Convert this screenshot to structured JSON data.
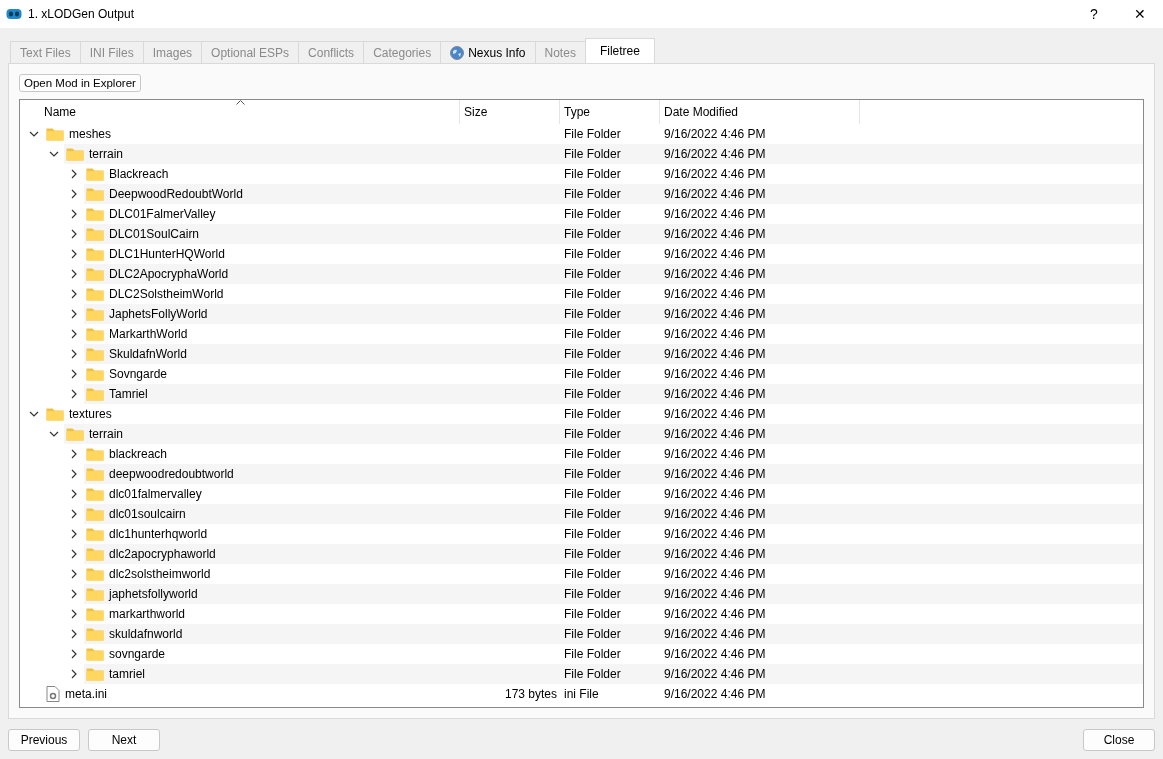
{
  "window": {
    "title": "1. xLODGen Output",
    "help_button": "?",
    "close_button": "✕"
  },
  "tabs": [
    {
      "label": "Text Files",
      "selected": false,
      "disabled": true
    },
    {
      "label": "INI Files",
      "selected": false,
      "disabled": true
    },
    {
      "label": "Images",
      "selected": false,
      "disabled": true
    },
    {
      "label": "Optional ESPs",
      "selected": false,
      "disabled": true
    },
    {
      "label": "Conflicts",
      "selected": false,
      "disabled": true
    },
    {
      "label": "Categories",
      "selected": false,
      "disabled": true
    },
    {
      "label": "Nexus Info",
      "selected": false,
      "disabled": false,
      "kind": "web"
    },
    {
      "label": "Notes",
      "selected": false,
      "disabled": true
    },
    {
      "label": "Filetree",
      "selected": true,
      "disabled": false
    }
  ],
  "open_button": "Open Mod in Explorer",
  "tree": {
    "columns": [
      "Name",
      "Size",
      "Type",
      "Date Modified"
    ],
    "items": [
      {
        "name": "meshes",
        "kind": "folder",
        "type": "File Folder",
        "date": "9/16/2022 4:46 PM",
        "expanded": true,
        "children": [
          {
            "name": "terrain",
            "kind": "folder",
            "type": "File Folder",
            "date": "9/16/2022 4:46 PM",
            "expanded": true,
            "children": [
              {
                "name": "Blackreach",
                "kind": "folder",
                "type": "File Folder",
                "date": "9/16/2022 4:46 PM",
                "expanded": false
              },
              {
                "name": "DeepwoodRedoubtWorld",
                "kind": "folder",
                "type": "File Folder",
                "date": "9/16/2022 4:46 PM",
                "expanded": false
              },
              {
                "name": "DLC01FalmerValley",
                "kind": "folder",
                "type": "File Folder",
                "date": "9/16/2022 4:46 PM",
                "expanded": false
              },
              {
                "name": "DLC01SoulCairn",
                "kind": "folder",
                "type": "File Folder",
                "date": "9/16/2022 4:46 PM",
                "expanded": false
              },
              {
                "name": "DLC1HunterHQWorld",
                "kind": "folder",
                "type": "File Folder",
                "date": "9/16/2022 4:46 PM",
                "expanded": false
              },
              {
                "name": "DLC2ApocryphaWorld",
                "kind": "folder",
                "type": "File Folder",
                "date": "9/16/2022 4:46 PM",
                "expanded": false
              },
              {
                "name": "DLC2SolstheimWorld",
                "kind": "folder",
                "type": "File Folder",
                "date": "9/16/2022 4:46 PM",
                "expanded": false
              },
              {
                "name": "JaphetsFollyWorld",
                "kind": "folder",
                "type": "File Folder",
                "date": "9/16/2022 4:46 PM",
                "expanded": false
              },
              {
                "name": "MarkarthWorld",
                "kind": "folder",
                "type": "File Folder",
                "date": "9/16/2022 4:46 PM",
                "expanded": false
              },
              {
                "name": "SkuldafnWorld",
                "kind": "folder",
                "type": "File Folder",
                "date": "9/16/2022 4:46 PM",
                "expanded": false
              },
              {
                "name": "Sovngarde",
                "kind": "folder",
                "type": "File Folder",
                "date": "9/16/2022 4:46 PM",
                "expanded": false
              },
              {
                "name": "Tamriel",
                "kind": "folder",
                "type": "File Folder",
                "date": "9/16/2022 4:46 PM",
                "expanded": false
              }
            ]
          }
        ]
      },
      {
        "name": "textures",
        "kind": "folder",
        "type": "File Folder",
        "date": "9/16/2022 4:46 PM",
        "expanded": true,
        "children": [
          {
            "name": "terrain",
            "kind": "folder",
            "type": "File Folder",
            "date": "9/16/2022 4:46 PM",
            "expanded": true,
            "children": [
              {
                "name": "blackreach",
                "kind": "folder",
                "type": "File Folder",
                "date": "9/16/2022 4:46 PM",
                "expanded": false
              },
              {
                "name": "deepwoodredoubtworld",
                "kind": "folder",
                "type": "File Folder",
                "date": "9/16/2022 4:46 PM",
                "expanded": false
              },
              {
                "name": "dlc01falmervalley",
                "kind": "folder",
                "type": "File Folder",
                "date": "9/16/2022 4:46 PM",
                "expanded": false
              },
              {
                "name": "dlc01soulcairn",
                "kind": "folder",
                "type": "File Folder",
                "date": "9/16/2022 4:46 PM",
                "expanded": false
              },
              {
                "name": "dlc1hunterhqworld",
                "kind": "folder",
                "type": "File Folder",
                "date": "9/16/2022 4:46 PM",
                "expanded": false
              },
              {
                "name": "dlc2apocryphaworld",
                "kind": "folder",
                "type": "File Folder",
                "date": "9/16/2022 4:46 PM",
                "expanded": false
              },
              {
                "name": "dlc2solstheimworld",
                "kind": "folder",
                "type": "File Folder",
                "date": "9/16/2022 4:46 PM",
                "expanded": false
              },
              {
                "name": "japhetsfollyworld",
                "kind": "folder",
                "type": "File Folder",
                "date": "9/16/2022 4:46 PM",
                "expanded": false
              },
              {
                "name": "markarthworld",
                "kind": "folder",
                "type": "File Folder",
                "date": "9/16/2022 4:46 PM",
                "expanded": false
              },
              {
                "name": "skuldafnworld",
                "kind": "folder",
                "type": "File Folder",
                "date": "9/16/2022 4:46 PM",
                "expanded": false
              },
              {
                "name": "sovngarde",
                "kind": "folder",
                "type": "File Folder",
                "date": "9/16/2022 4:46 PM",
                "expanded": false
              },
              {
                "name": "tamriel",
                "kind": "folder",
                "type": "File Folder",
                "date": "9/16/2022 4:46 PM",
                "expanded": false
              }
            ]
          }
        ]
      },
      {
        "name": "meta.ini",
        "kind": "file",
        "size": "173 bytes",
        "type": "ini File",
        "date": "9/16/2022 4:46 PM"
      }
    ]
  },
  "buttons": {
    "left": [
      "Previous",
      "Next"
    ],
    "right": [
      "Close"
    ]
  }
}
